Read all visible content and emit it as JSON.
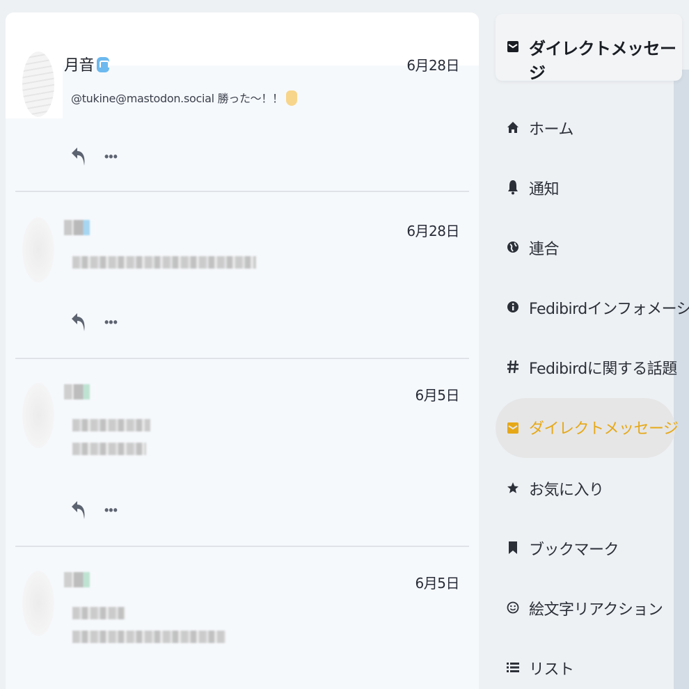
{
  "timeline": {
    "statuses": [
      {
        "display_name": "月音",
        "date": "6月28日",
        "content": "@tukine@mastodon.social 勝った～！！",
        "blurred": false
      },
      {
        "display_name": "",
        "date": "6月28日",
        "content": "",
        "blurred": true
      },
      {
        "display_name": "",
        "date": "6月5日",
        "content": "",
        "blurred": true
      },
      {
        "display_name": "",
        "date": "6月5日",
        "content": "",
        "blurred": true
      }
    ],
    "actions": {
      "reply_icon": "reply-icon",
      "more_icon": "more-icon",
      "more_label": "•••"
    }
  },
  "navigation": {
    "header": {
      "icon": "envelope-icon",
      "label": "ダイレクトメッセージ"
    },
    "items": [
      {
        "icon": "home-icon",
        "label": "ホーム",
        "active": false
      },
      {
        "icon": "bell-icon",
        "label": "通知",
        "active": false
      },
      {
        "icon": "globe-icon",
        "label": "連合",
        "active": false
      },
      {
        "icon": "info-icon",
        "label": "Fedibirdインフォメーション",
        "active": false
      },
      {
        "icon": "hashtag-icon",
        "label": "Fedibirdに関する話題",
        "active": false
      },
      {
        "icon": "envelope-icon",
        "label": "ダイレクトメッセージ",
        "active": true
      },
      {
        "icon": "star-icon",
        "label": "お気に入り",
        "active": false
      },
      {
        "icon": "bookmark-icon",
        "label": "ブックマーク",
        "active": false
      },
      {
        "icon": "smile-icon",
        "label": "絵文字リアクション",
        "active": false
      },
      {
        "icon": "list-icon",
        "label": "リスト",
        "active": false
      }
    ]
  },
  "colors": {
    "accent": "#e6a817",
    "background": "#eef1f4",
    "timeline_background": "#f6f9fc",
    "text": "#282c37"
  }
}
